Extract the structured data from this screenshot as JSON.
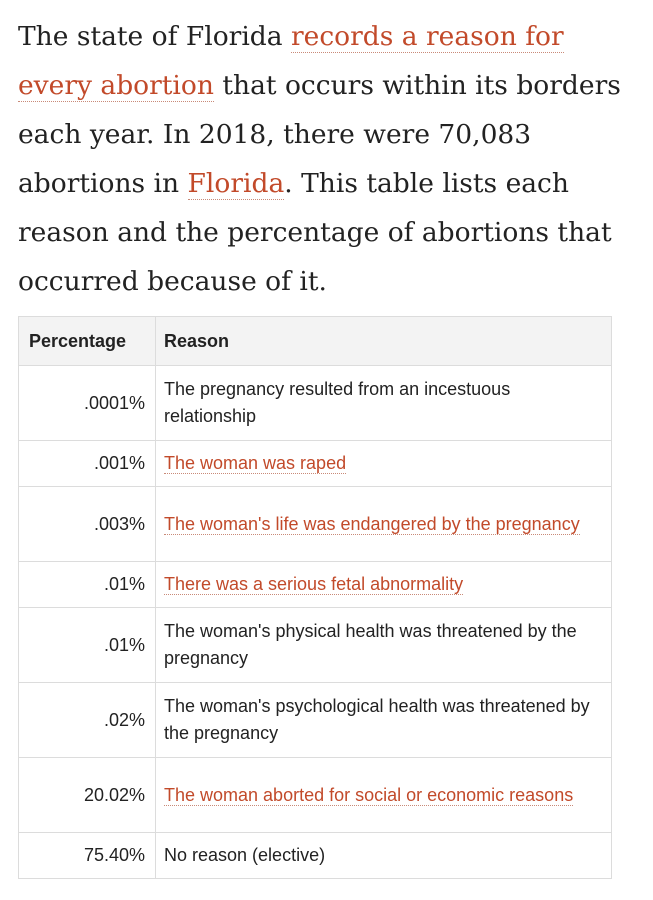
{
  "intro": {
    "part1": "The state of Florida ",
    "link1": "records a reason for every abortion",
    "part2": " that occurs within its borders each year. In 2018, there were 70,083 abortions in ",
    "link2": "Florida",
    "part3": ". This table lists each reason and the percentage of abortions that occurred because of it."
  },
  "table": {
    "headers": {
      "percentage": "Percentage",
      "reason": "Reason"
    },
    "rows": [
      {
        "percentage": ".0001%",
        "reason": "The pregnancy resulted from an incestuous relationship",
        "linked": false
      },
      {
        "percentage": ".001%",
        "reason": "The woman was raped",
        "linked": true
      },
      {
        "percentage": ".003%",
        "reason": "The woman's life was endangered by the pregnancy",
        "linked": true
      },
      {
        "percentage": ".01%",
        "reason": "There was a serious fetal abnormality",
        "linked": true
      },
      {
        "percentage": ".01%",
        "reason": "The woman's physical health was threatened by the pregnancy",
        "linked": false
      },
      {
        "percentage": ".02%",
        "reason": "The woman's psychological health was threatened by the pregnancy",
        "linked": false
      },
      {
        "percentage": "20.02%",
        "reason": "The woman aborted for social or economic reasons",
        "linked": true
      },
      {
        "percentage": "75.40%",
        "reason": "No reason (elective)",
        "linked": false
      }
    ]
  },
  "colors": {
    "link": "#c24a2a",
    "text": "#222222",
    "header_bg": "#f3f3f3",
    "border": "#dcdcdc"
  }
}
